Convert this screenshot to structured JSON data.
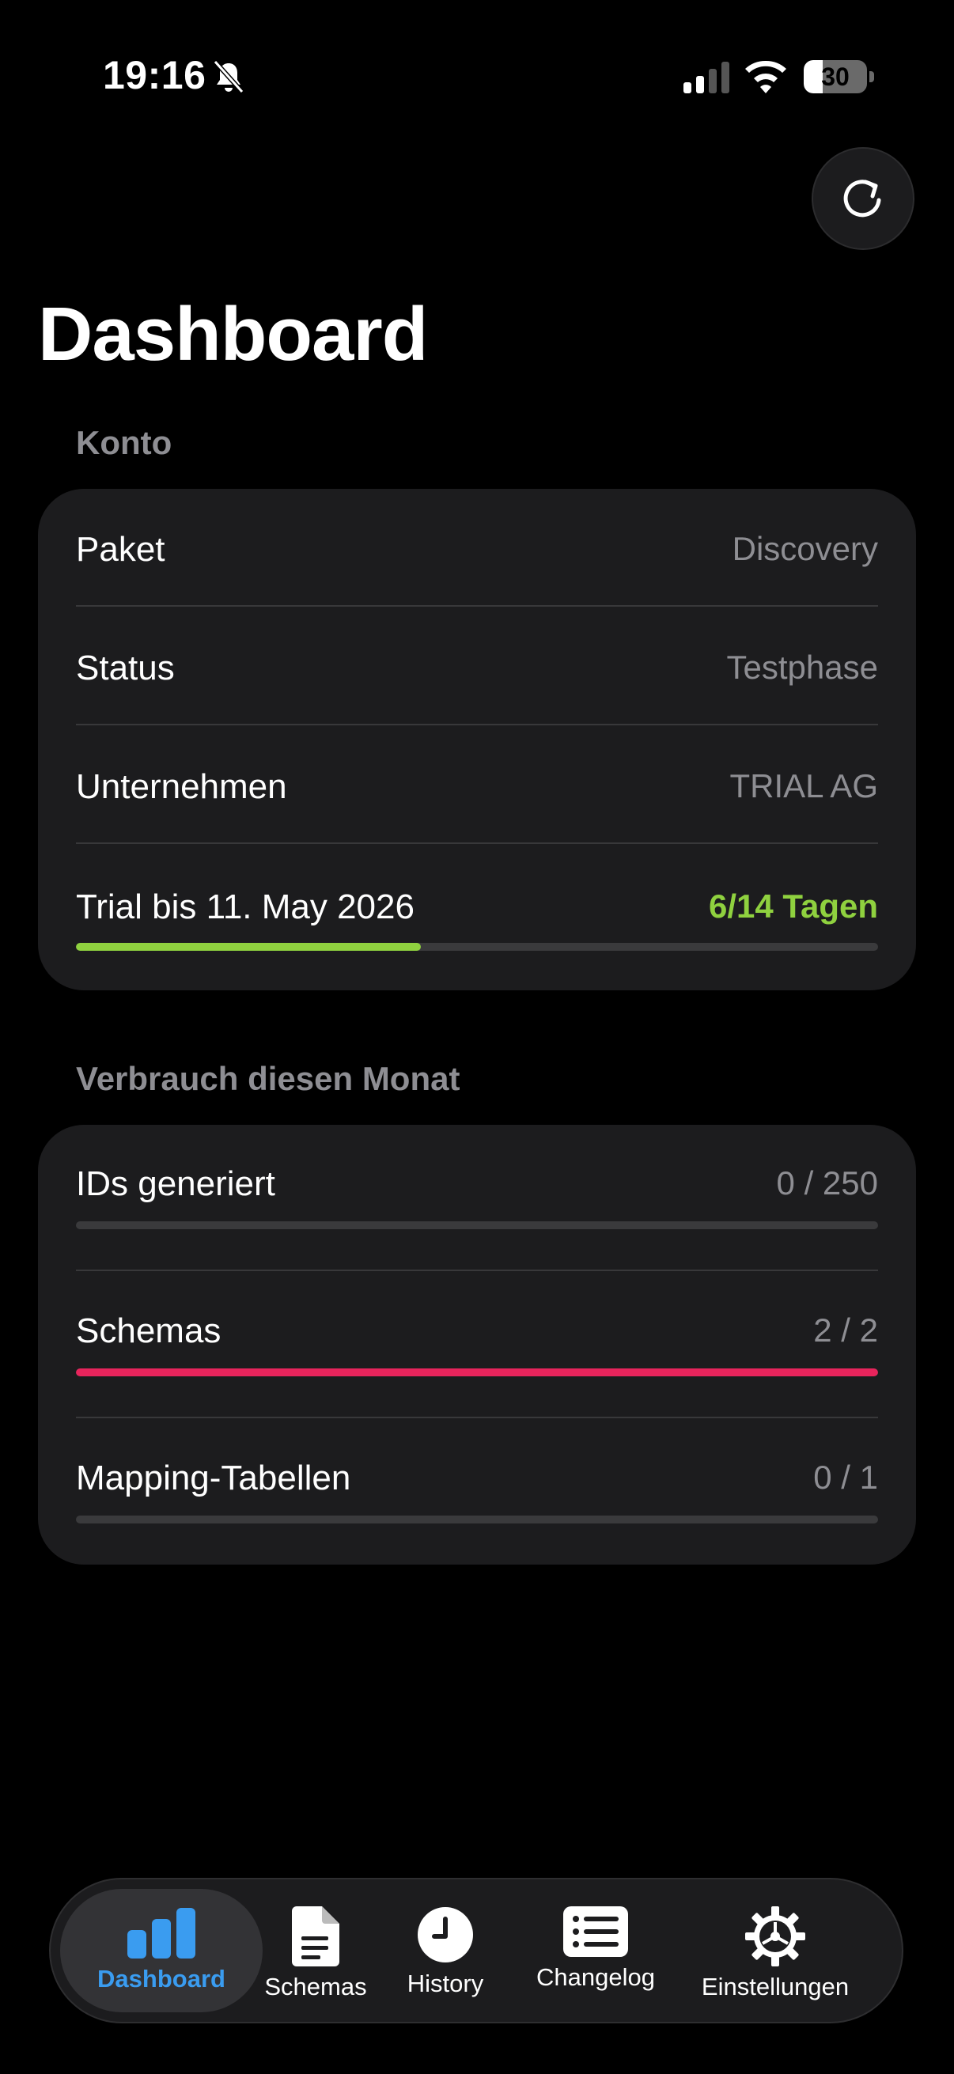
{
  "status_bar": {
    "time": "19:16",
    "battery": "30",
    "battery_level": 0.3,
    "icons": [
      "bell-slash-icon",
      "cellular-signal-icon",
      "wifi-icon",
      "battery-icon"
    ]
  },
  "header": {
    "title": "Dashboard",
    "refresh_icon": "arrow-clockwise-icon"
  },
  "account_section": {
    "title": "Konto",
    "rows": [
      {
        "label": "Paket",
        "value": "Discovery"
      },
      {
        "label": "Status",
        "value": "Testphase"
      },
      {
        "label": "Unternehmen",
        "value": "TRIAL AG"
      }
    ],
    "trial": {
      "label": "Trial bis 11. May 2026",
      "value": "6/14 Tagen",
      "progress": 0.43,
      "color": "#8fd13f"
    }
  },
  "usage_section": {
    "title": "Verbrauch diesen Monat",
    "rows": [
      {
        "label": "IDs generiert",
        "value": "0 / 250",
        "progress": 0.0
      },
      {
        "label": "Schemas",
        "value": "2 / 2",
        "progress": 1.0,
        "color": "#e8245c"
      },
      {
        "label": "Mapping-Tabellen",
        "value": "0 / 1",
        "progress": 0.0
      }
    ]
  },
  "tab_bar": {
    "active": "Dashboard",
    "active_color": "#3a9cf0",
    "tabs": [
      {
        "label": "Dashboard",
        "icon": "bar-chart-icon"
      },
      {
        "label": "Schemas",
        "icon": "document-icon"
      },
      {
        "label": "History",
        "icon": "clock-icon"
      },
      {
        "label": "Changelog",
        "icon": "list-icon"
      },
      {
        "label": "Einstellungen",
        "icon": "gear-icon"
      }
    ]
  }
}
